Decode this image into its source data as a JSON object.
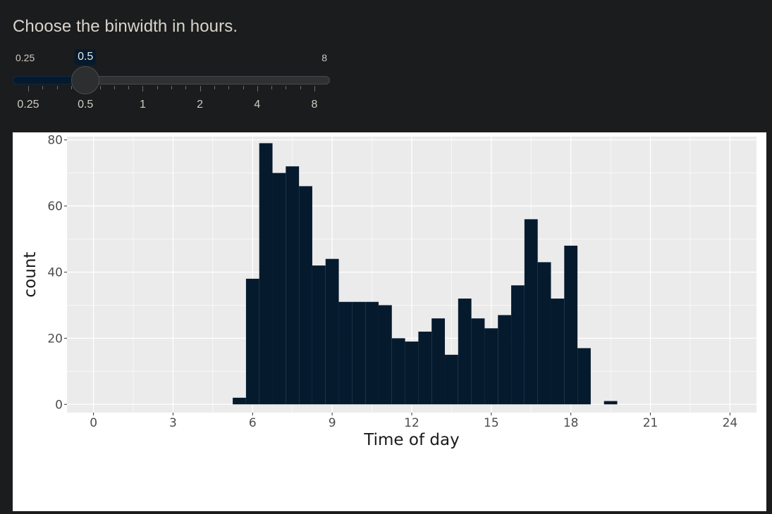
{
  "input": {
    "label": "Choose the binwidth in hours.",
    "slider": {
      "min_label": "0.25",
      "max_label": "8",
      "value_label": "0.5",
      "value": 0.5,
      "grid_labels": [
        "0.25",
        "0.5",
        "1",
        "2",
        "4",
        "8"
      ]
    }
  },
  "chart_data": {
    "type": "bar",
    "xlabel": "Time of day",
    "ylabel": "count",
    "xlim": [
      -1,
      25
    ],
    "ylim": [
      -2.5,
      81
    ],
    "xticks": [
      0,
      3,
      6,
      9,
      12,
      15,
      18,
      21,
      24
    ],
    "yticks": [
      0,
      20,
      40,
      60,
      80
    ],
    "binwidth": 0.5,
    "bins": [
      {
        "x0": 5.25,
        "count": 2
      },
      {
        "x0": 5.75,
        "count": 38
      },
      {
        "x0": 6.25,
        "count": 79
      },
      {
        "x0": 6.75,
        "count": 70
      },
      {
        "x0": 7.25,
        "count": 72
      },
      {
        "x0": 7.75,
        "count": 66
      },
      {
        "x0": 8.25,
        "count": 42
      },
      {
        "x0": 8.75,
        "count": 44
      },
      {
        "x0": 9.25,
        "count": 31
      },
      {
        "x0": 9.75,
        "count": 31
      },
      {
        "x0": 10.25,
        "count": 31
      },
      {
        "x0": 10.75,
        "count": 30
      },
      {
        "x0": 11.25,
        "count": 20
      },
      {
        "x0": 11.75,
        "count": 19
      },
      {
        "x0": 12.25,
        "count": 22
      },
      {
        "x0": 12.75,
        "count": 26
      },
      {
        "x0": 13.25,
        "count": 15
      },
      {
        "x0": 13.75,
        "count": 32
      },
      {
        "x0": 14.25,
        "count": 26
      },
      {
        "x0": 14.75,
        "count": 23
      },
      {
        "x0": 15.25,
        "count": 27
      },
      {
        "x0": 15.75,
        "count": 36
      },
      {
        "x0": 16.25,
        "count": 56
      },
      {
        "x0": 16.75,
        "count": 43
      },
      {
        "x0": 17.25,
        "count": 32
      },
      {
        "x0": 17.75,
        "count": 48
      },
      {
        "x0": 18.25,
        "count": 17
      },
      {
        "x0": 19.25,
        "count": 1
      }
    ],
    "colors": {
      "bar": "#061a2e",
      "panel": "#ebebeb",
      "grid": "#ffffff",
      "text": "#4d4d4d",
      "title": "#1a1a1a"
    },
    "grid": true,
    "legend": "none"
  }
}
